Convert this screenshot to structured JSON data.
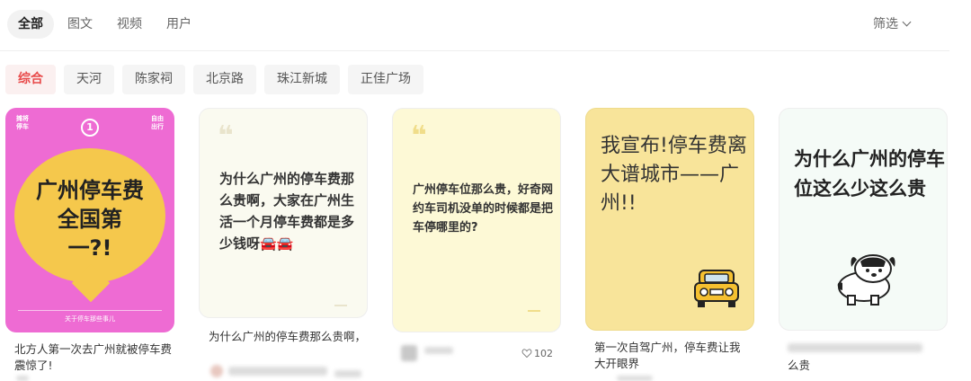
{
  "tabs": [
    "全部",
    "图文",
    "视频",
    "用户"
  ],
  "filter_label": "筛选",
  "chips": [
    "综合",
    "天河",
    "陈家祠",
    "北京路",
    "珠江新城",
    "正佳广场"
  ],
  "cards": [
    {
      "poster": {
        "top_left": "摊将停车",
        "top_right": "自由出行",
        "number": "1",
        "headline": "广州停车费全国第一?!",
        "footer": "关于停车那些事儿"
      },
      "caption": "北方人第一次去广州就被停车费震惊了!"
    },
    {
      "poster": {
        "text": "为什么广州的停车费那么贵啊，大家在广州生活一个月停车费都是多少钱呀🚘🚘"
      },
      "caption": "为什么广州的停车费那么贵啊，"
    },
    {
      "poster": {
        "text": "广州停车位那么贵，好奇网约车司机没单的时候都是把车停哪里的?"
      },
      "likes": "102"
    },
    {
      "poster": {
        "text": "我宣布!停车费离大谱城市——广州!!"
      },
      "caption": "第一次自驾广州，停车费让我大开眼界"
    },
    {
      "poster": {
        "text": "为什么广州的停车位这么少这么贵"
      },
      "caption": "么贵"
    }
  ],
  "colors": {
    "accent_chip": "#e84a4a",
    "card1_bg": "#ee6bd3",
    "card1_blob": "#f5c84c",
    "card4_bg": "#f8e49a"
  },
  "icons": [
    "chevron-down-icon",
    "heart-icon",
    "car-icon",
    "dog-icon"
  ]
}
